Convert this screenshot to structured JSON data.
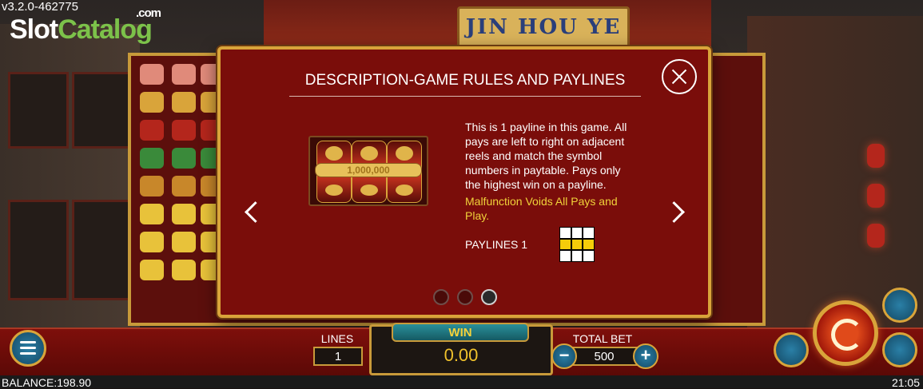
{
  "app": {
    "version": "v3.2.0-462775",
    "logo_slot": "Slot",
    "logo_catalog": "Catalog",
    "logo_com": ".com",
    "game_title": "JIN HOU YE"
  },
  "dialog": {
    "title": "DESCRIPTION-GAME RULES AND PAYLINES",
    "thumbnail_text": "1,000,000",
    "description": "This is 1 payline in this game. All pays are left to right on adjacent reels and match the symbol numbers in paytable. Pays only the highest win on a payline.",
    "warning": "Malfunction Voids All Pays and Play.",
    "paylines_label": "PAYLINES 1",
    "payline_grid": [
      0,
      0,
      0,
      1,
      1,
      1,
      0,
      0,
      0
    ],
    "page_count": 3,
    "active_page": 3
  },
  "bottom_bar": {
    "lines_label": "LINES",
    "lines_value": "1",
    "win_label": "WIN",
    "win_value": "0.00",
    "total_bet_label": "TOTAL BET",
    "total_bet_value": "500",
    "minus_label": "−",
    "plus_label": "+"
  },
  "status": {
    "balance": "BALANCE:198.90",
    "clock": "21:05"
  },
  "colors": {
    "dialog_bg": "#7a0d0a",
    "gold": "#d9a43a",
    "warning_text": "#f0d23a",
    "win_value": "#f0c22c"
  }
}
